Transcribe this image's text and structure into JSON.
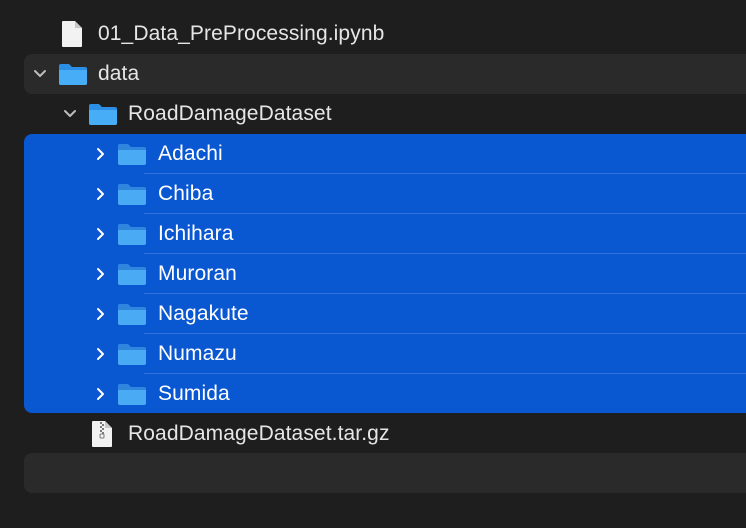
{
  "file_list": {
    "items": [
      {
        "label": "01_Data_PreProcessing.ipynb",
        "icon": "document-icon",
        "indent": 0,
        "expandable": false,
        "selected": false
      },
      {
        "label": "data",
        "icon": "folder-icon",
        "indent": 0,
        "expandable": true,
        "expanded": true,
        "selected": false
      },
      {
        "label": "RoadDamageDataset",
        "icon": "folder-icon",
        "indent": 1,
        "expandable": true,
        "expanded": true,
        "selected": false
      },
      {
        "label": "Adachi",
        "icon": "folder-icon",
        "indent": 2,
        "expandable": true,
        "expanded": false,
        "selected": true
      },
      {
        "label": "Chiba",
        "icon": "folder-icon",
        "indent": 2,
        "expandable": true,
        "expanded": false,
        "selected": true
      },
      {
        "label": "Ichihara",
        "icon": "folder-icon",
        "indent": 2,
        "expandable": true,
        "expanded": false,
        "selected": true
      },
      {
        "label": "Muroran",
        "icon": "folder-icon",
        "indent": 2,
        "expandable": true,
        "expanded": false,
        "selected": true
      },
      {
        "label": "Nagakute",
        "icon": "folder-icon",
        "indent": 2,
        "expandable": true,
        "expanded": false,
        "selected": true
      },
      {
        "label": "Numazu",
        "icon": "folder-icon",
        "indent": 2,
        "expandable": true,
        "expanded": false,
        "selected": true
      },
      {
        "label": "Sumida",
        "icon": "folder-icon",
        "indent": 2,
        "expandable": true,
        "expanded": false,
        "selected": true
      },
      {
        "label": "RoadDamageDataset.tar.gz",
        "icon": "archive-icon",
        "indent": 1,
        "expandable": false,
        "selected": false
      }
    ]
  },
  "colors": {
    "background": "#1e1e1e",
    "alternate_row": "#2a2a2a",
    "selection": "#0a57d2",
    "folder": "#3fa6f5",
    "text": "#e6e6e6",
    "selected_text": "#ffffff"
  }
}
